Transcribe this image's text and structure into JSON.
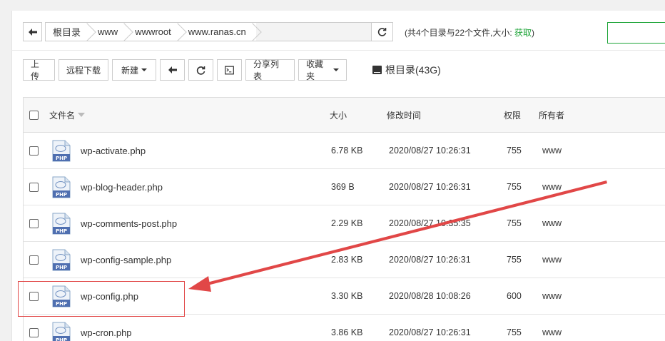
{
  "path": {
    "segments": [
      "根目录",
      "www",
      "wwwroot",
      "www.ranas.cn"
    ],
    "info_prefix": "(共4个目录与22个文件,大小: ",
    "info_link": "获取",
    "info_suffix": ")"
  },
  "toolbar": {
    "upload": "上传",
    "remote_download": "远程下载",
    "new": "新建",
    "share_list": "分享列表",
    "favorites": "收藏夹",
    "disk": "根目录(43G)"
  },
  "table": {
    "columns": {
      "name": "文件名",
      "size": "大小",
      "modified": "修改时间",
      "permission": "权限",
      "owner": "所有者"
    },
    "rows": [
      {
        "name": "wp-activate.php",
        "size": "6.78 KB",
        "modified": "2020/08/27 10:26:31",
        "permission": "755",
        "owner": "www",
        "icon": "php-file-icon"
      },
      {
        "name": "wp-blog-header.php",
        "size": "369 B",
        "modified": "2020/08/27 10:26:31",
        "permission": "755",
        "owner": "www",
        "icon": "php-file-icon"
      },
      {
        "name": "wp-comments-post.php",
        "size": "2.29 KB",
        "modified": "2020/08/27 10:35:35",
        "permission": "755",
        "owner": "www",
        "icon": "php-file-icon"
      },
      {
        "name": "wp-config-sample.php",
        "size": "2.83 KB",
        "modified": "2020/08/27 10:26:31",
        "permission": "755",
        "owner": "www",
        "icon": "php-file-icon"
      },
      {
        "name": "wp-config.php",
        "size": "3.30 KB",
        "modified": "2020/08/28 10:08:26",
        "permission": "600",
        "owner": "www",
        "icon": "php-file-icon"
      },
      {
        "name": "wp-cron.php",
        "size": "3.86 KB",
        "modified": "2020/08/27 10:26:31",
        "permission": "755",
        "owner": "www",
        "icon": "php-file-icon"
      }
    ]
  },
  "icon_text": "PHP",
  "annotation_color": "#e14747",
  "accent_color": "#20a53a"
}
